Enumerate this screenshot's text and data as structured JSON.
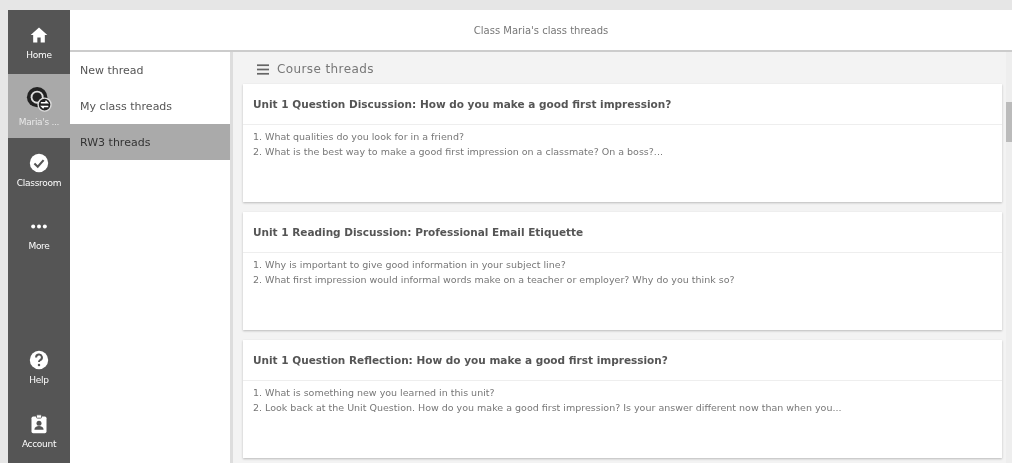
{
  "nav": [
    {
      "label": "Home",
      "kind": "home",
      "selected": false
    },
    {
      "label": "Maria's ...",
      "kind": "class",
      "selected": true
    },
    {
      "label": "Classroom",
      "kind": "check",
      "selected": false
    },
    {
      "label": "More",
      "kind": "more",
      "selected": false
    },
    {
      "label": "Help",
      "kind": "help",
      "selected": false
    },
    {
      "label": "Account",
      "kind": "account",
      "selected": false
    }
  ],
  "header": {
    "title": "Class Maria's class threads"
  },
  "menu": [
    {
      "label": "New thread",
      "selected": false
    },
    {
      "label": "My class threads",
      "selected": false
    },
    {
      "label": "RW3 threads",
      "selected": true
    }
  ],
  "section": {
    "title": "Course threads"
  },
  "threads": [
    {
      "title": "Unit 1 Question Discussion: How do you make a good first impression?",
      "lines": [
        "1. What qualities do you look for in a friend?",
        "2. What is the best way to make a good first impression on a classmate? On a boss?..."
      ]
    },
    {
      "title": "Unit 1 Reading Discussion: Professional Email Etiquette",
      "lines": [
        "1. Why is important to give good information in your subject line?",
        "2. What first impression would informal words make on a teacher or employer? Why do you think so?"
      ]
    },
    {
      "title": "Unit 1 Question Reflection: How do you make a good first impression?",
      "lines": [
        "1. What is something new you learned in this unit?",
        "2. Look back at the Unit Question. How do you make a good first impression? Is your answer different now than when you..."
      ]
    }
  ]
}
